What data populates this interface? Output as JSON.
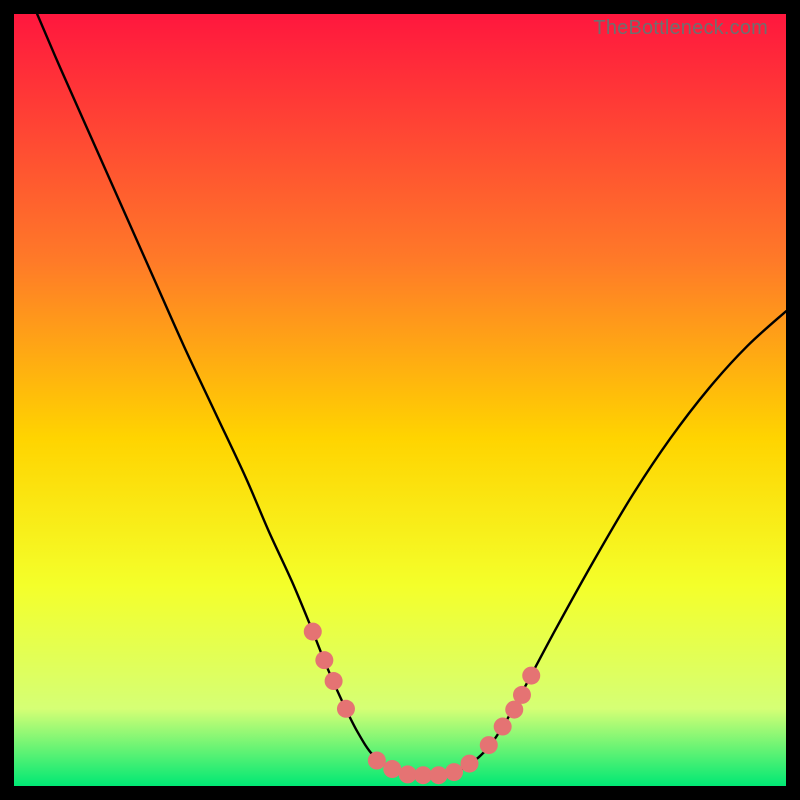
{
  "watermark": "TheBottleneck.com",
  "chart_data": {
    "type": "line",
    "title": "",
    "xlabel": "",
    "ylabel": "",
    "xlim": [
      0,
      100
    ],
    "ylim": [
      0,
      100
    ],
    "background_gradient": {
      "top_color": "#ff173e",
      "mid_upper_color": "#ff7a28",
      "mid_color": "#ffd400",
      "mid_lower_color": "#f4ff2a",
      "near_bottom_color": "#d5ff75",
      "bottom_color": "#00e874"
    },
    "series": [
      {
        "name": "bottleneck-curve",
        "type": "line",
        "stroke": "#000000",
        "x": [
          3,
          6,
          10,
          14,
          18,
          22,
          26,
          30,
          33,
          36,
          38.5,
          40.5,
          42.5,
          44.5,
          46.5,
          49,
          52,
          55,
          58,
          61,
          63.5,
          66,
          70,
          75,
          80,
          85,
          90,
          95,
          100
        ],
        "values": [
          100,
          93,
          84,
          75,
          66,
          57,
          48.5,
          40,
          33,
          26.5,
          20.5,
          15.5,
          11,
          7,
          4,
          2.2,
          1.4,
          1.4,
          2.2,
          4.5,
          8,
          12.5,
          20,
          29,
          37.5,
          45,
          51.5,
          57,
          61.5
        ]
      },
      {
        "name": "curve-markers",
        "type": "scatter",
        "marker_color": "#e57373",
        "marker_radius": 9,
        "x": [
          38.7,
          40.2,
          41.4,
          43.0,
          47.0,
          49.0,
          51.0,
          53.0,
          55.0,
          57.0,
          59.0,
          61.5,
          63.3,
          64.8,
          65.8,
          67.0
        ],
        "values": [
          20.0,
          16.3,
          13.6,
          10.0,
          3.3,
          2.2,
          1.5,
          1.4,
          1.4,
          1.8,
          2.9,
          5.3,
          7.7,
          9.9,
          11.8,
          14.3
        ]
      }
    ]
  }
}
